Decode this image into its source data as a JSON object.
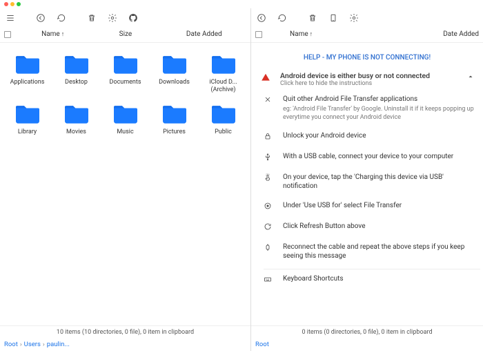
{
  "cols": {
    "name": "Name",
    "size": "Size",
    "date": "Date Added"
  },
  "left": {
    "folders": [
      {
        "label": "Applications"
      },
      {
        "label": "Desktop"
      },
      {
        "label": "Documents"
      },
      {
        "label": "Downloads"
      },
      {
        "label": "iCloud D... (Archive)"
      },
      {
        "label": "Library"
      },
      {
        "label": "Movies"
      },
      {
        "label": "Music"
      },
      {
        "label": "Pictures"
      },
      {
        "label": "Public"
      }
    ],
    "status": "10 items (10 directories, 0 file), 0 item in clipboard",
    "crumbs": [
      "Root",
      "Users",
      "paulin..."
    ]
  },
  "right": {
    "help": "HELP - MY PHONE IS NOT CONNECTING!",
    "alert": {
      "title": "Android device is either busy or not connected",
      "subtitle": "Click here to hide the instructions"
    },
    "steps": [
      {
        "icon": "close",
        "text": "Quit other Android File Transfer applications",
        "sub": "eg: 'Android File Transfer' by Google. Uninstall it if it keeps popping up everytime you connect your Android device"
      },
      {
        "icon": "lock",
        "text": "Unlock your Android device"
      },
      {
        "icon": "usb",
        "text": "With a USB cable, connect your device to your computer"
      },
      {
        "icon": "tap",
        "text": "On your device, tap the 'Charging this device via USB' notification"
      },
      {
        "icon": "radio",
        "text": "Under 'Use USB for' select File Transfer"
      },
      {
        "icon": "refresh",
        "text": "Click Refresh Button above"
      },
      {
        "icon": "watch",
        "text": "Reconnect the cable and repeat the above steps if you keep seeing this message"
      }
    ],
    "shortcuts": "Keyboard Shortcuts",
    "status": "0 items (0 directories, 0 file), 0 item in clipboard",
    "crumbs": [
      "Root"
    ]
  }
}
